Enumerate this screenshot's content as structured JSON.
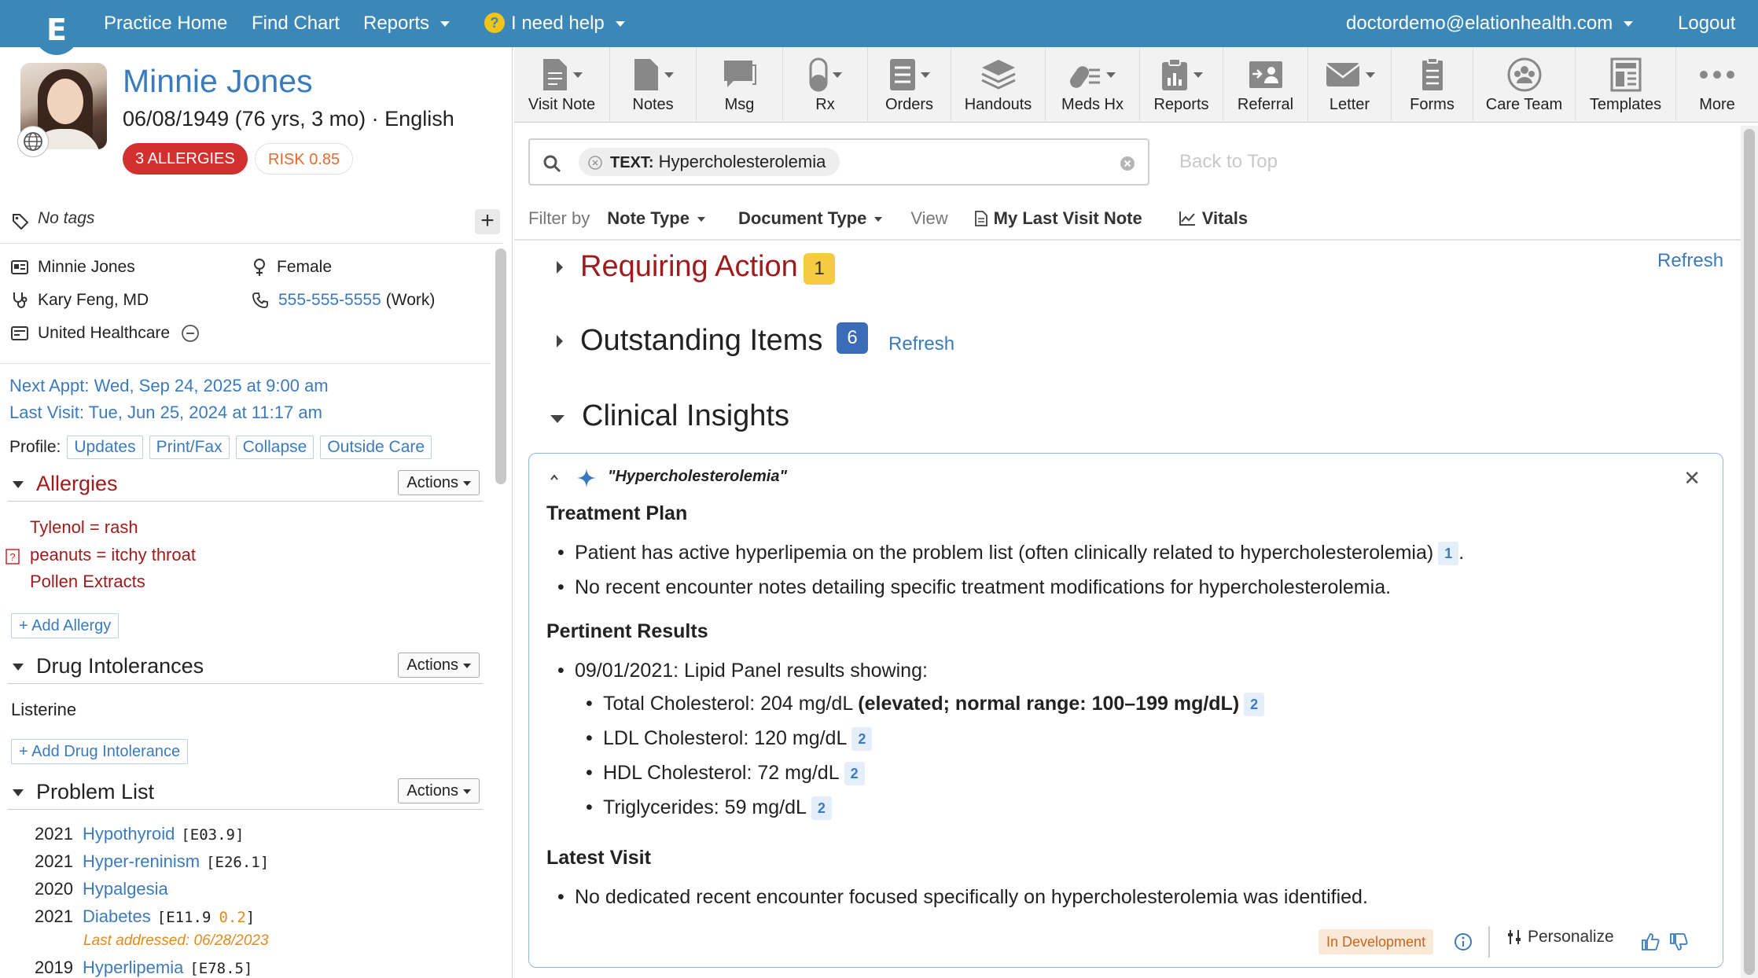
{
  "nav": {
    "items": [
      "Practice Home",
      "Find Chart",
      "Reports"
    ],
    "help": "I need help",
    "help_icon": "?",
    "user": "doctordemo@elationhealth.com",
    "logout": "Logout",
    "logo": "E",
    "bar_color": "#3b87b8"
  },
  "patient": {
    "name": "Minnie Jones",
    "dob_line": "06/08/1949 (76 yrs, 3 mo) · English",
    "allergy_badge": "3 ALLERGIES",
    "risk_badge": "RISK 0.85",
    "tags": "No tags",
    "demo_name": "Minnie Jones",
    "gender": "Female",
    "provider": "Kary Feng, MD",
    "phone": "555-555-5555",
    "phone_type": "(Work)",
    "insurance": "United Healthcare",
    "next_appt": "Next Appt: Wed, Sep 24, 2025 at 9:00 am",
    "last_visit": "Last Visit: Tue, Jun 25, 2024 at 11:17 am",
    "profile_label": "Profile:",
    "profile_buttons": [
      "Updates",
      "Print/Fax",
      "Collapse",
      "Outside Care"
    ]
  },
  "sections": {
    "actions_label": "Actions",
    "allergies": {
      "title": "Allergies",
      "items": [
        "Tylenol = rash",
        "peanuts = itchy throat",
        "Pollen Extracts"
      ],
      "add": "+ Add Allergy",
      "alert_icon": "?"
    },
    "drug_intol": {
      "title": "Drug Intolerances",
      "items": [
        "Listerine"
      ],
      "add": "+ Add Drug Intolerance"
    },
    "problems": {
      "title": "Problem List",
      "items": [
        {
          "year": "2021",
          "name": "Hypothyroid",
          "code": "[E03.9]"
        },
        {
          "year": "2021",
          "name": "Hyper-reninism",
          "code": "[E26.1]"
        },
        {
          "year": "2020",
          "name": "Hypalgesia",
          "code": ""
        },
        {
          "year": "2021",
          "name": "Diabetes",
          "code": "[E11.9",
          "value": "0.2",
          "code_end": "]"
        },
        {
          "year": "2019",
          "name": "Hyperlipemia",
          "code": "[E78.5]"
        }
      ],
      "last_addressed": "Last addressed: 06/28/2023"
    }
  },
  "toolbar": {
    "items": [
      {
        "label": "Visit Note",
        "icon": "document-icon",
        "caret": true
      },
      {
        "label": "Notes",
        "icon": "note-icon",
        "caret": true
      },
      {
        "label": "Msg",
        "icon": "message-icon",
        "caret": false
      },
      {
        "label": "Rx",
        "icon": "pill-icon",
        "caret": true
      },
      {
        "label": "Orders",
        "icon": "list-icon",
        "caret": true
      },
      {
        "label": "Handouts",
        "icon": "layers-icon",
        "caret": false
      },
      {
        "label": "Meds Hx",
        "icon": "pills-history-icon",
        "caret": true
      },
      {
        "label": "Reports",
        "icon": "clipboard-chart-icon",
        "caret": true
      },
      {
        "label": "Referral",
        "icon": "referral-icon",
        "caret": false
      },
      {
        "label": "Letter",
        "icon": "envelope-icon",
        "caret": true
      },
      {
        "label": "Forms",
        "icon": "form-icon",
        "caret": false
      },
      {
        "label": "Care Team",
        "icon": "care-team-icon",
        "caret": false
      },
      {
        "label": "Templates",
        "icon": "templates-icon",
        "caret": false
      },
      {
        "label": "More",
        "icon": "more-icon",
        "caret": false
      }
    ]
  },
  "search": {
    "chip_prefix": "TEXT:",
    "chip_value": "Hypercholesterolemia",
    "back_to_top": "Back to Top"
  },
  "filter": {
    "label": "Filter by",
    "note_type": "Note Type",
    "document_type": "Document Type",
    "view": "View",
    "last_visit_note": "My Last Visit Note",
    "vitals": "Vitals"
  },
  "main": {
    "requiring_action": "Requiring Action",
    "requiring_action_count": "1",
    "refresh": "Refresh",
    "outstanding_items": "Outstanding Items",
    "outstanding_count": "6",
    "refresh2": "Refresh",
    "clinical_insights": "Clinical Insights"
  },
  "insight": {
    "query": "\"Hypercholesterolemia\"",
    "treatment_title": "Treatment Plan",
    "treatment": [
      {
        "text": "Patient has active hyperlipemia on the problem list (often clinically related to hypercholesterolemia)",
        "ref": "1",
        "suffix": "."
      },
      {
        "text": "No recent encounter notes detailing specific treatment modifications for hypercholesterolemia.",
        "ref": "",
        "suffix": ""
      }
    ],
    "results_title": "Pertinent Results",
    "results_intro": "09/01/2021: Lipid Panel results showing:",
    "results": [
      {
        "text": "Total Cholesterol: 204 mg/dL",
        "bold": "(elevated; normal range: 100–199 mg/dL)",
        "ref": "2"
      },
      {
        "text": "LDL Cholesterol: 120 mg/dL",
        "bold": "",
        "ref": "2"
      },
      {
        "text": "HDL Cholesterol: 72 mg/dL",
        "bold": "",
        "ref": "2"
      },
      {
        "text": "Triglycerides: 59 mg/dL",
        "bold": "",
        "ref": "2"
      }
    ],
    "latest_title": "Latest Visit",
    "latest": "No dedicated recent encounter focused specifically on hypercholesterolemia was identified.",
    "status": "In Development",
    "personalize": "Personalize"
  }
}
